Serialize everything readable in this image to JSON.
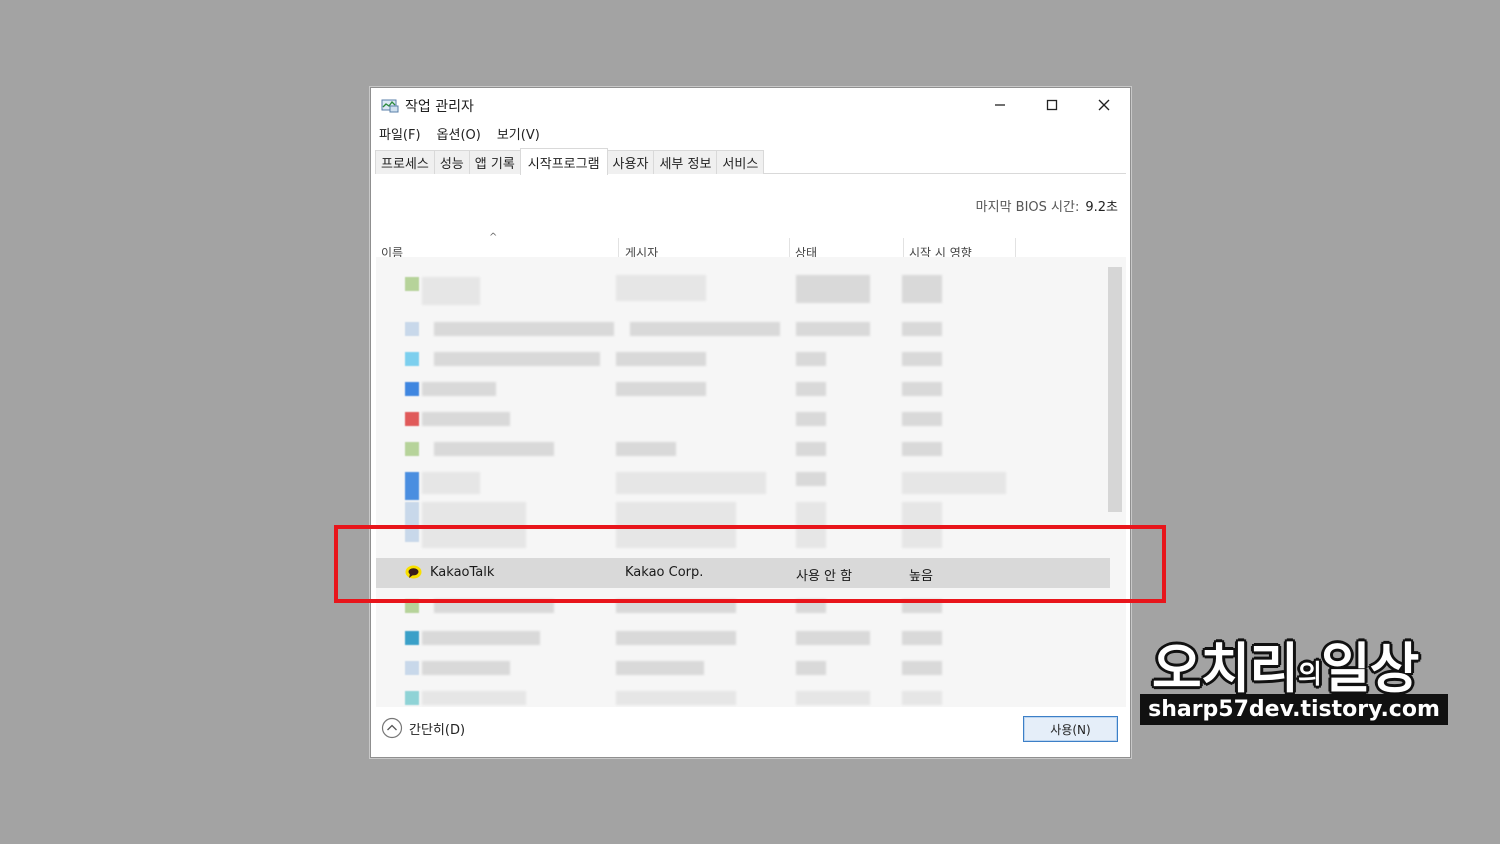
{
  "window": {
    "title": "작업 관리자",
    "controls": {
      "minimize": "minimize-icon",
      "maximize": "maximize-icon",
      "close": "close-icon"
    }
  },
  "menu": [
    "파일(F)",
    "옵션(O)",
    "보기(V)"
  ],
  "tabs": [
    "프로세스",
    "성능",
    "앱 기록",
    "시작프로그램",
    "사용자",
    "세부 정보",
    "서비스"
  ],
  "active_tab": "시작프로그램",
  "bios": {
    "label": "마지막 BIOS 시간:",
    "value": "9.2초"
  },
  "columns": [
    "이름",
    "게시자",
    "상태",
    "시작 시 영향"
  ],
  "highlighted_row": {
    "name": "KakaoTalk",
    "publisher": "Kakao Corp.",
    "status": "사용 안 함",
    "impact": "높음",
    "icon": "kakaotalk-icon"
  },
  "footer": {
    "collapse_label": "간단히(D)",
    "enable_button": "사용(N)"
  },
  "watermark": {
    "title_a": "오치리",
    "title_mid": "의",
    "title_b": "일상",
    "url": "sharp57dev.tistory.com"
  },
  "colors": {
    "highlight": "#e8151b",
    "kakao_yellow": "#f9e000",
    "accent": "#3c7fc7"
  }
}
